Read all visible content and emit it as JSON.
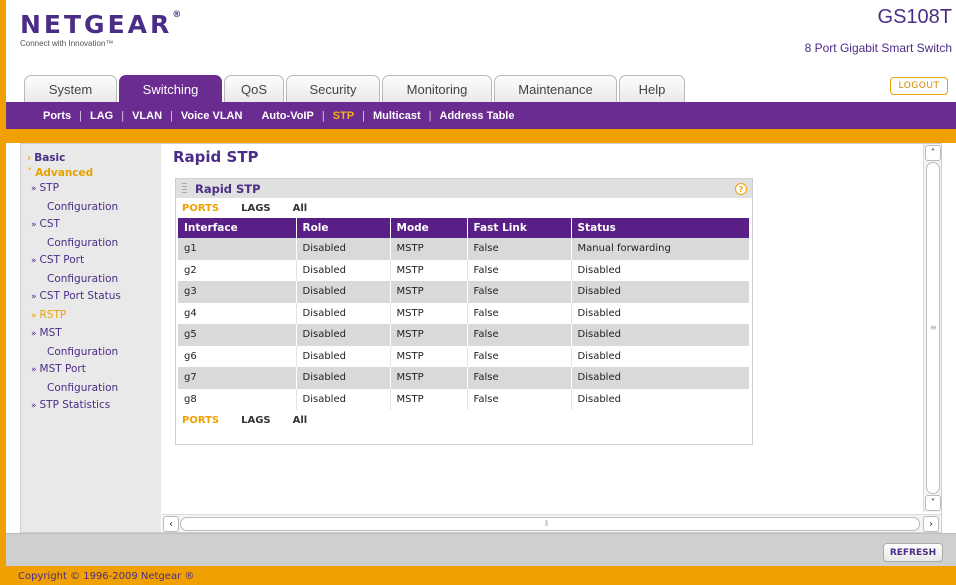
{
  "brand": {
    "logo": "NETGEAR",
    "logo_mark": "®",
    "tagline": "Connect with Innovation™",
    "model": "GS108T",
    "model_desc": "8 Port Gigabit Smart Switch",
    "logout": "LOGOUT"
  },
  "tabs": [
    "System",
    "Switching",
    "QoS",
    "Security",
    "Monitoring",
    "Maintenance",
    "Help"
  ],
  "active_tab": "Switching",
  "subnav": [
    "Ports",
    "LAG",
    "VLAN",
    "Voice VLAN",
    "Auto-VoIP",
    "STP",
    "Multicast",
    "Address Table"
  ],
  "active_subnav": "STP",
  "sidebar": {
    "basic": "Basic",
    "advanced": "Advanced",
    "items": [
      {
        "line1": "STP",
        "line2": "Configuration"
      },
      {
        "line1": "CST",
        "line2": "Configuration"
      },
      {
        "line1": "CST Port",
        "line2": "Configuration"
      },
      {
        "line1": "CST Port Status",
        "line2": ""
      },
      {
        "line1": "RSTP",
        "line2": ""
      },
      {
        "line1": "MST",
        "line2": "Configuration"
      },
      {
        "line1": "MST Port",
        "line2": "Configuration"
      },
      {
        "line1": "STP Statistics",
        "line2": ""
      }
    ],
    "active_item": "RSTP"
  },
  "page": {
    "title": "Rapid STP",
    "panel_title": "Rapid STP",
    "help": "?"
  },
  "filters": {
    "ports": "PORTS",
    "lags": "LAGS",
    "all": "All"
  },
  "table": {
    "headers": [
      "Interface",
      "Role",
      "Mode",
      "Fast Link",
      "Status"
    ],
    "rows": [
      [
        "g1",
        "Disabled",
        "MSTP",
        "False",
        "Manual forwarding"
      ],
      [
        "g2",
        "Disabled",
        "MSTP",
        "False",
        "Disabled"
      ],
      [
        "g3",
        "Disabled",
        "MSTP",
        "False",
        "Disabled"
      ],
      [
        "g4",
        "Disabled",
        "MSTP",
        "False",
        "Disabled"
      ],
      [
        "g5",
        "Disabled",
        "MSTP",
        "False",
        "Disabled"
      ],
      [
        "g6",
        "Disabled",
        "MSTP",
        "False",
        "Disabled"
      ],
      [
        "g7",
        "Disabled",
        "MSTP",
        "False",
        "Disabled"
      ],
      [
        "g8",
        "Disabled",
        "MSTP",
        "False",
        "Disabled"
      ]
    ]
  },
  "refresh": "REFRESH",
  "copyright": "Copyright © 1996-2009 Netgear ®",
  "colors": {
    "purple": "#6a2c91",
    "orange": "#f0a000"
  }
}
